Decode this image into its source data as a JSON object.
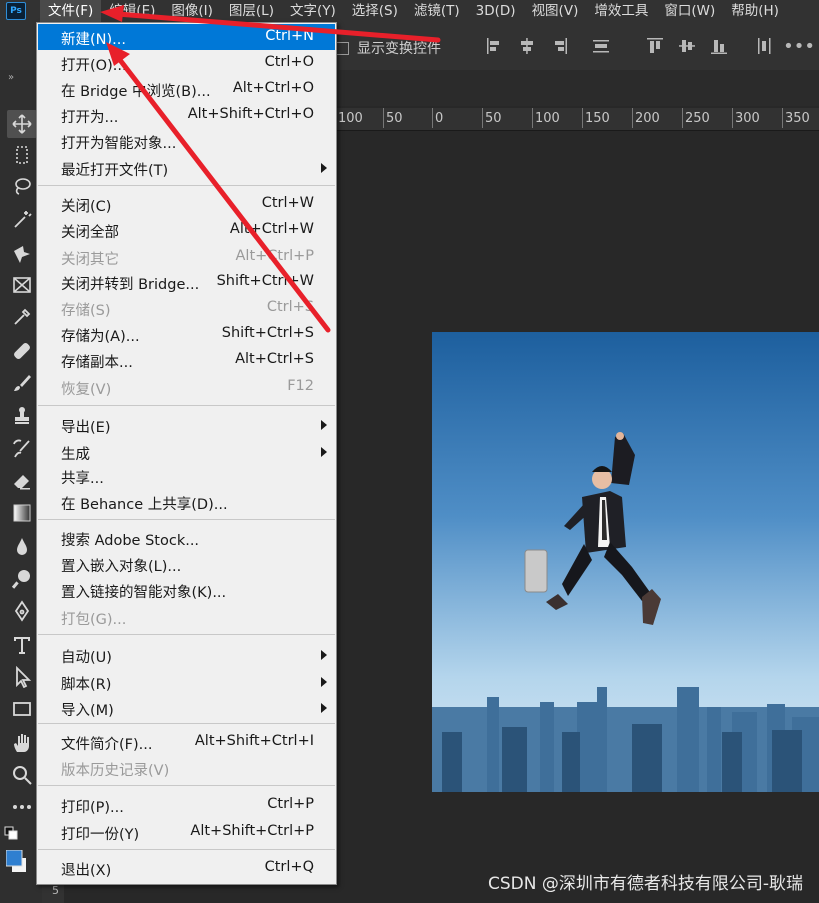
{
  "app": {
    "logo_text": "Ps"
  },
  "menubar": {
    "items": [
      {
        "label": "文件(F)"
      },
      {
        "label": "编辑(E)"
      },
      {
        "label": "图像(I)"
      },
      {
        "label": "图层(L)"
      },
      {
        "label": "文字(Y)"
      },
      {
        "label": "选择(S)"
      },
      {
        "label": "滤镜(T)"
      },
      {
        "label": "3D(D)"
      },
      {
        "label": "视图(V)"
      },
      {
        "label": "增效工具"
      },
      {
        "label": "窗口(W)"
      },
      {
        "label": "帮助(H)"
      }
    ]
  },
  "options": {
    "show_transform_label": "显示变换控件",
    "show_transform_checked": false
  },
  "ruler": {
    "ticks": [
      "100",
      "50",
      "0",
      "50",
      "100",
      "150",
      "200",
      "250",
      "300",
      "350"
    ]
  },
  "vertical_ruler_label": "5",
  "file_menu": {
    "items": [
      {
        "label": "新建(N)...",
        "shortcut": "Ctrl+N",
        "highlighted": true
      },
      {
        "label": "打开(O)...",
        "shortcut": "Ctrl+O"
      },
      {
        "label": "在 Bridge 中浏览(B)...",
        "shortcut": "Alt+Ctrl+O"
      },
      {
        "label": "打开为...",
        "shortcut": "Alt+Shift+Ctrl+O"
      },
      {
        "label": "打开为智能对象...",
        "shortcut": ""
      },
      {
        "label": "最近打开文件(T)",
        "shortcut": "",
        "submenu": true
      },
      {
        "label": "关闭(C)",
        "shortcut": "Ctrl+W"
      },
      {
        "label": "关闭全部",
        "shortcut": "Alt+Ctrl+W"
      },
      {
        "label": "关闭其它",
        "shortcut": "Alt+Ctrl+P",
        "disabled": true
      },
      {
        "label": "关闭并转到 Bridge...",
        "shortcut": "Shift+Ctrl+W"
      },
      {
        "label": "存储(S)",
        "shortcut": "Ctrl+S",
        "disabled": true
      },
      {
        "label": "存储为(A)...",
        "shortcut": "Shift+Ctrl+S"
      },
      {
        "label": "存储副本...",
        "shortcut": "Alt+Ctrl+S"
      },
      {
        "label": "恢复(V)",
        "shortcut": "F12",
        "disabled": true
      },
      {
        "label": "导出(E)",
        "shortcut": "",
        "submenu": true
      },
      {
        "label": "生成",
        "shortcut": "",
        "submenu": true
      },
      {
        "label": "共享...",
        "shortcut": ""
      },
      {
        "label": "在 Behance 上共享(D)...",
        "shortcut": ""
      },
      {
        "label": "搜索 Adobe Stock...",
        "shortcut": ""
      },
      {
        "label": "置入嵌入对象(L)...",
        "shortcut": ""
      },
      {
        "label": "置入链接的智能对象(K)...",
        "shortcut": ""
      },
      {
        "label": "打包(G)...",
        "shortcut": "",
        "disabled": true
      },
      {
        "label": "自动(U)",
        "shortcut": "",
        "submenu": true
      },
      {
        "label": "脚本(R)",
        "shortcut": "",
        "submenu": true
      },
      {
        "label": "导入(M)",
        "shortcut": "",
        "submenu": true
      },
      {
        "label": "文件简介(F)...",
        "shortcut": "Alt+Shift+Ctrl+I"
      },
      {
        "label": "版本历史记录(V)",
        "shortcut": "",
        "disabled": true
      },
      {
        "label": "打印(P)...",
        "shortcut": "Ctrl+P"
      },
      {
        "label": "打印一份(Y)",
        "shortcut": "Alt+Shift+Ctrl+P"
      },
      {
        "label": "退出(X)",
        "shortcut": "Ctrl+Q"
      }
    ]
  },
  "colors": {
    "annotation_arrow": "#e8202a",
    "highlight": "#0078d7",
    "foreground_swatch": "#2f7fd0"
  },
  "watermark": "CSDN @深圳市有德者科技有限公司-耿瑞"
}
